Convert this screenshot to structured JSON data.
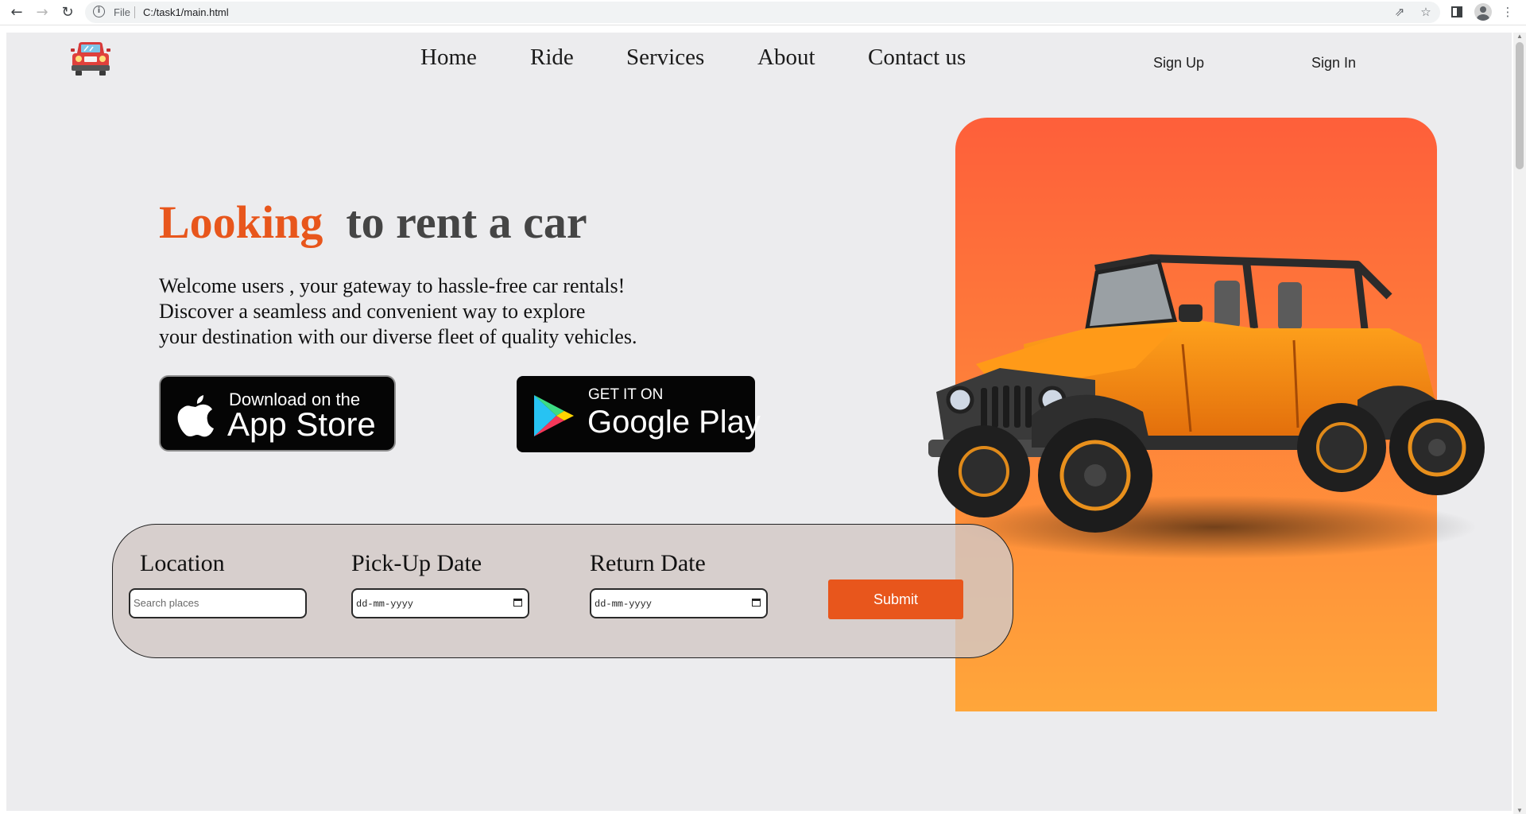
{
  "browser": {
    "back_icon": "arrow-left-icon",
    "forward_icon": "arrow-right-icon",
    "reload_icon": "reload-icon",
    "security_label": "File",
    "url": "C:/task1/main.html"
  },
  "header": {
    "logo_icon": "car-logo-icon",
    "menu": [
      {
        "label": "Home"
      },
      {
        "label": "Ride"
      },
      {
        "label": "Services"
      },
      {
        "label": "About"
      },
      {
        "label": "Contact us"
      }
    ],
    "sign_up": "Sign Up",
    "sign_in": "Sign In"
  },
  "hero": {
    "title_accent": "Looking",
    "title_rest": "to rent a car",
    "description": [
      "Welcome users , your gateway to hassle-free car rentals!",
      "Discover a seamless and convenient way to explore",
      "your destination with our diverse fleet of quality vehicles."
    ]
  },
  "stores": {
    "apple": {
      "line1": "Download on the",
      "line2": "App Store",
      "icon": "apple-icon"
    },
    "google": {
      "line1": "GET IT ON",
      "line2": "Google Play",
      "icon": "google-play-icon"
    }
  },
  "booking": {
    "location_label": "Location",
    "location_placeholder": "Search places",
    "pickup_label": "Pick-Up Date",
    "pickup_value": "dd-mm-yyyy",
    "return_label": "Return Date",
    "return_value": "dd-mm-yyyy",
    "submit": "Submit"
  },
  "colors": {
    "accent": "#e8561c",
    "panel_top": "#fe5f3a",
    "panel_bottom": "#ffa63a",
    "background": "#ececee"
  }
}
